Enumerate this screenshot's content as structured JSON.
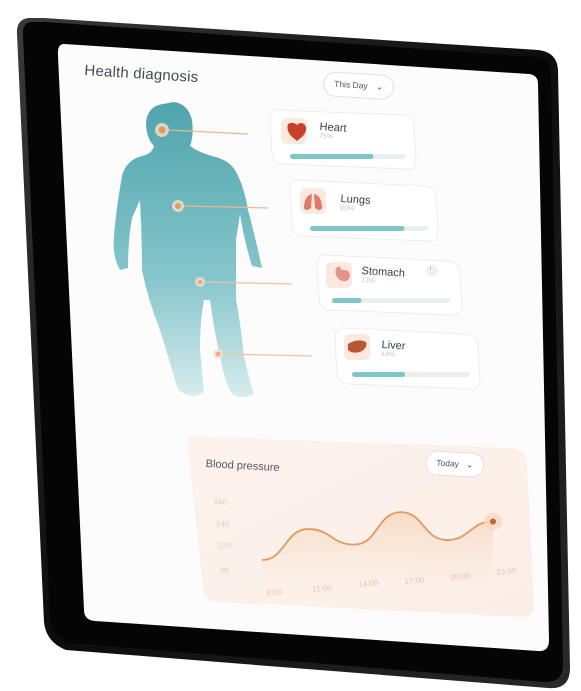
{
  "header": {
    "title": "Health diagnosis",
    "period_selector": "This Day",
    "period_chevron": "chevron-down-icon"
  },
  "organs": [
    {
      "name": "Heart",
      "value": "75%",
      "progress": 0.72,
      "icon": "heart-organ-icon"
    },
    {
      "name": "Lungs",
      "value": "90%",
      "progress": 0.8,
      "icon": "lungs-organ-icon"
    },
    {
      "name": "Stomach",
      "value": "13%",
      "progress": 0.25,
      "icon": "stomach-organ-icon",
      "info_icon": "info-icon",
      "info_text": "i"
    },
    {
      "name": "Liver",
      "value": "44%",
      "progress": 0.45,
      "icon": "liver-organ-icon"
    }
  ],
  "body_figure": {
    "icon": "human-body-figure"
  },
  "blood_pressure": {
    "title": "Blood pressure",
    "period_selector": "Today",
    "period_chevron": "chevron-down-icon"
  },
  "chart_data": {
    "type": "area",
    "title": "Blood pressure",
    "categories": [
      "8:00",
      "11:00",
      "14:00",
      "17:00",
      "20:00",
      "23:00"
    ],
    "y_ticks": [
      "160",
      "140",
      "120",
      "80"
    ],
    "series": [
      {
        "values": [
          80,
          122,
          104,
          148,
          114,
          140
        ]
      }
    ],
    "ylim": [
      80,
      160
    ],
    "grid": false
  },
  "colors": {
    "accent_teal": "#7fc6c9",
    "accent_orange": "#e19a5e",
    "organ_icon_bg": "#fbe9df"
  }
}
